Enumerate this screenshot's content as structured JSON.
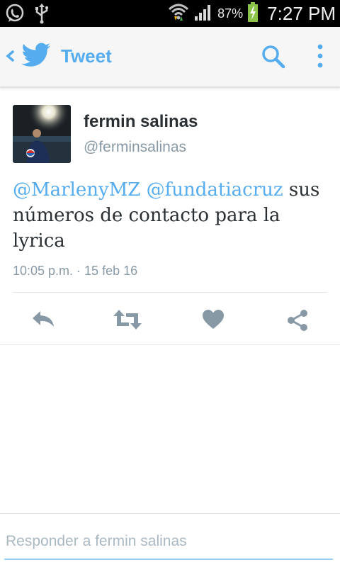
{
  "status_bar": {
    "battery_percent": "87%",
    "time": "7:27 PM",
    "icons": [
      "whatsapp-icon",
      "usb-icon",
      "wifi-icon",
      "signal-icon",
      "battery-charging-icon"
    ]
  },
  "action_bar": {
    "title": "Tweet",
    "icons": [
      "back-chevron-icon",
      "twitter-bird-icon",
      "search-icon",
      "overflow-menu-icon"
    ],
    "accent_color": "#55acee"
  },
  "tweet": {
    "author_name": "fermin salinas",
    "author_handle": "@ferminsalinas",
    "mention_1": "@MarlenyMZ",
    "mention_2": "@fundatiacruz",
    "body_text": "sus números de contacto para la lyrica",
    "timestamp": "10:05 p.m. · 15 feb 16",
    "actions": [
      "reply-icon",
      "retweet-icon",
      "like-icon",
      "share-icon"
    ]
  },
  "reply_box": {
    "placeholder": "Responder a fermin salinas"
  }
}
